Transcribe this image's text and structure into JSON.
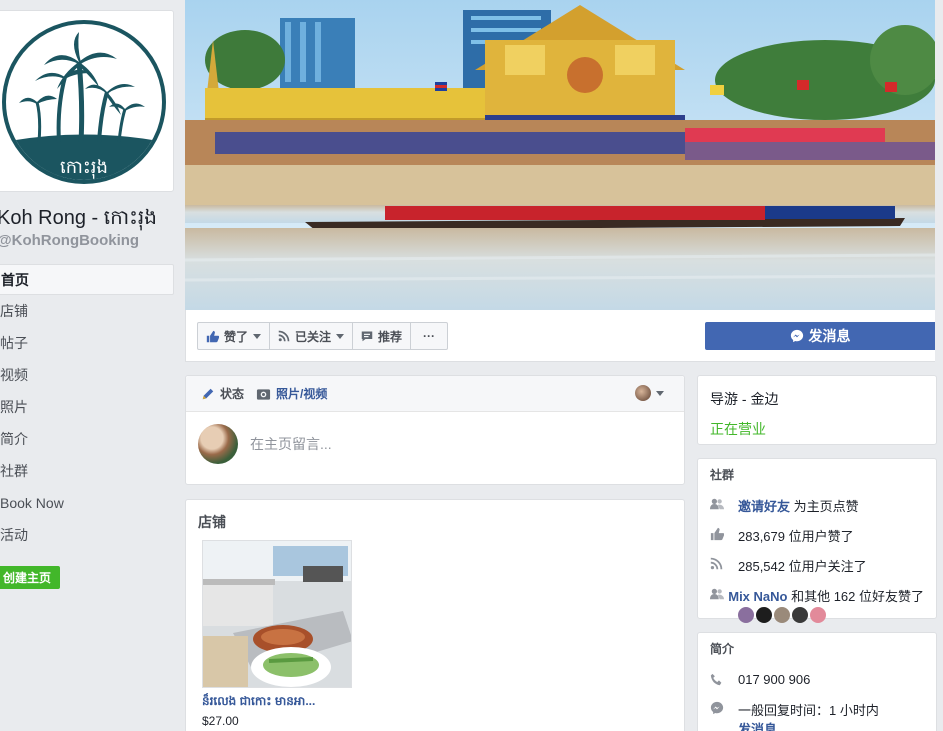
{
  "page": {
    "name": "Koh Rong - កោះរុង",
    "handle": "@KohRongBooking",
    "logo_text": "កោះរុង"
  },
  "nav": {
    "items": [
      {
        "label": "首页",
        "active": true
      },
      {
        "label": "店铺"
      },
      {
        "label": "帖子"
      },
      {
        "label": "视频"
      },
      {
        "label": "照片"
      },
      {
        "label": "简介"
      },
      {
        "label": "社群"
      },
      {
        "label": "Book Now"
      },
      {
        "label": "活动"
      }
    ],
    "create_page": "创建主页"
  },
  "actions": {
    "like": "赞了",
    "follow": "已关注",
    "share": "推荐",
    "more": "···",
    "message": "发消息"
  },
  "composer": {
    "tab_status": "状态",
    "tab_photo": "照片/视频",
    "placeholder": "在主页留言..."
  },
  "shop": {
    "title": "店铺",
    "product": {
      "name": "ន៏រលេង ជាកោះ មានអា...",
      "price": "$27.00"
    }
  },
  "info": {
    "category": "导游 - 金边",
    "status": "正在营业"
  },
  "community": {
    "title": "社群",
    "invite_link": "邀请好友",
    "invite_suffix": " 为主页点赞",
    "likes": "283,679 位用户赞了",
    "follows": "285,542 位用户关注了",
    "friend_name": "Mix NaNo",
    "friend_suffix": " 和其他 162 位好友赞了",
    "face_colors": [
      "#8a6f9e",
      "#1d1d1d",
      "#9a8a7a",
      "#3a3a3a",
      "#e28a9a"
    ]
  },
  "about": {
    "title": "简介",
    "phone": "017 900 906",
    "response": "一般回复时间：1 小时内",
    "message_link": "发消息"
  },
  "colors": {
    "brand_blue": "#4267b2",
    "link_blue": "#365899",
    "green": "#42b72a",
    "logo_teal": "#1b5560"
  }
}
